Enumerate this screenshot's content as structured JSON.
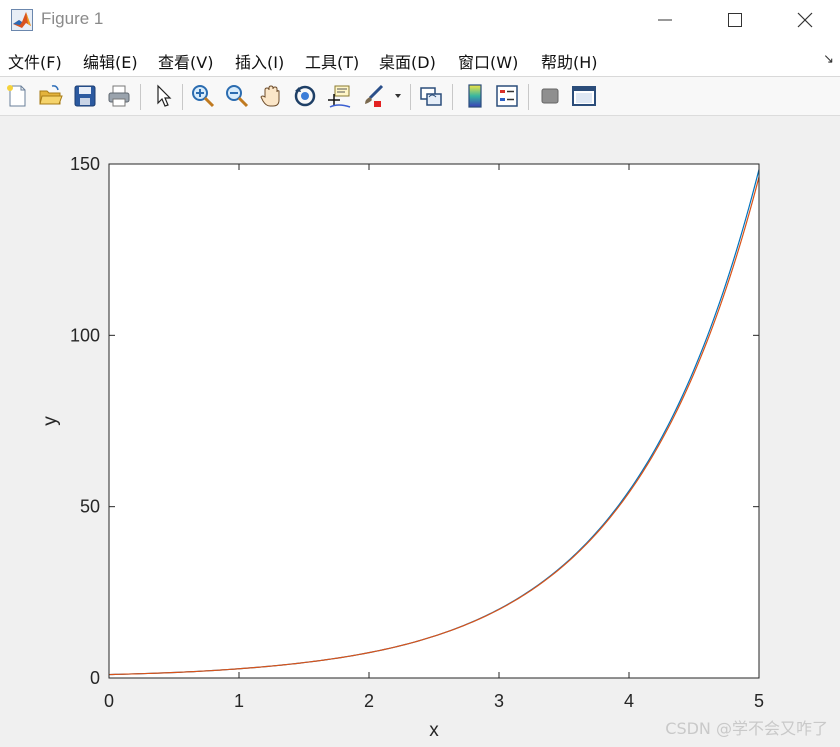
{
  "window": {
    "title": "Figure 1",
    "icon": "matlab-logo-icon",
    "controls": [
      "minimize-icon",
      "maximize-icon",
      "close-icon"
    ]
  },
  "menu": {
    "items": [
      "文件(F)",
      "编辑(E)",
      "查看(V)",
      "插入(I)",
      "工具(T)",
      "桌面(D)",
      "窗口(W)",
      "帮助(H)"
    ],
    "dock_arrow": "↘"
  },
  "toolbar": {
    "buttons": [
      "new-figure-icon",
      "open-file-icon",
      "save-icon",
      "print-icon",
      "pointer-icon",
      "zoom-in-icon",
      "zoom-out-icon",
      "pan-hand-icon",
      "rotate-3d-icon",
      "data-cursor-icon",
      "brush-icon",
      "brush-dropdown-icon",
      "link-plot-icon",
      "colorbar-icon",
      "legend-icon",
      "hide-plot-tools-icon",
      "show-plot-tools-icon"
    ]
  },
  "colors": {
    "series1": "#0072bd",
    "series2": "#d95319",
    "background": "#f0f0f0",
    "axes_background": "#ffffff"
  },
  "chart_data": {
    "type": "line",
    "title": "",
    "xlabel": "x",
    "ylabel": "y",
    "xlim": [
      0,
      5
    ],
    "ylim": [
      0,
      150
    ],
    "xticks": [
      "0",
      "1",
      "2",
      "3",
      "4",
      "5"
    ],
    "yticks": [
      "0",
      "50",
      "100",
      "150"
    ],
    "grid": false,
    "legend": "none",
    "x": [
      0,
      0.5,
      1,
      1.5,
      2,
      2.5,
      3,
      3.5,
      4,
      4.5,
      5
    ],
    "series": [
      {
        "values": [
          1,
          1.6,
          2.7,
          4.5,
          7.4,
          12.2,
          20.1,
          33.1,
          54.6,
          90.0,
          148.4
        ],
        "color": "#0072bd"
      },
      {
        "values": [
          1,
          1.6,
          2.7,
          4.5,
          7.4,
          12.2,
          20.0,
          32.9,
          54.1,
          88.9,
          146.2
        ],
        "color": "#d95319"
      }
    ]
  },
  "watermark": "CSDN @学不会又咋了"
}
